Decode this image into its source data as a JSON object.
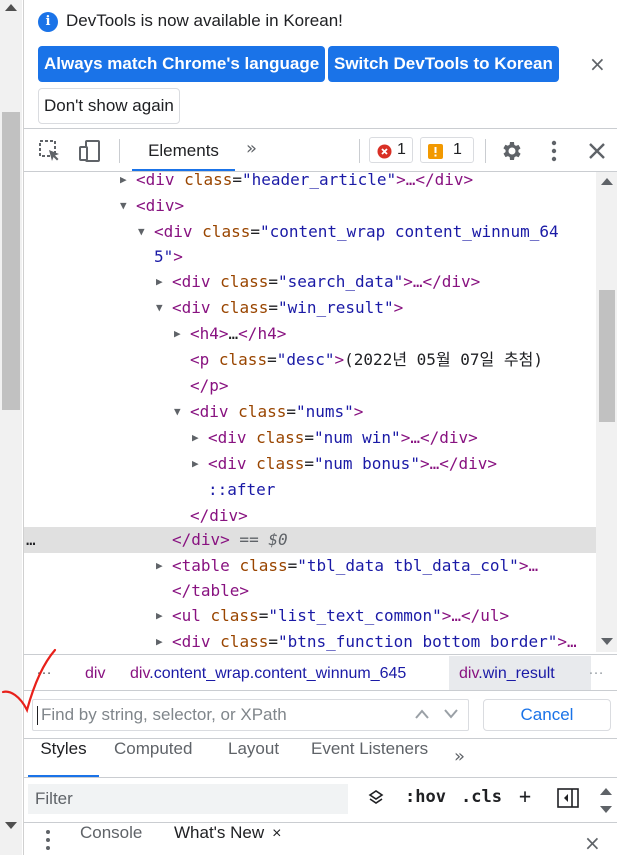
{
  "infobar": {
    "message": "DevTools is now available in Korean!",
    "btn_match": "Always match Chrome's language",
    "btn_switch": "Switch DevTools to Korean",
    "btn_dont_show": "Don't show again",
    "close_glyph": "×"
  },
  "toolbar": {
    "tab_elements": "Elements",
    "more_tabs_glyph": "»",
    "error_count": "1",
    "warning_count": "1",
    "colors": {
      "accent": "#1a73e8",
      "error": "#d93025",
      "warning": "#f29900"
    }
  },
  "tree": {
    "lines": [
      {
        "tri": "▶",
        "tag_open": "<div ",
        "attr": "class",
        "eq": "=",
        "val": "\"header_article\"",
        "close": ">…</div>"
      },
      {
        "tri": "▼",
        "tag_open": "<div>"
      },
      {
        "tri": "▼",
        "tag_open": "<div ",
        "attr": "class",
        "eq": "=",
        "val": "\"content_wrap content_winnum_64"
      },
      {
        "val": "5\"",
        "close": ">"
      },
      {
        "tri": "▶",
        "tag_open": "<div ",
        "attr": "class",
        "eq": "=",
        "val": "\"search_data\"",
        "close": ">…</div>"
      },
      {
        "tri": "▼",
        "tag_open": "<div ",
        "attr": "class",
        "eq": "=",
        "val": "\"win_result\"",
        "close": ">"
      },
      {
        "tri": "▶",
        "tag_open": "<h4>",
        "text": "…",
        "close": "</h4>"
      },
      {
        "tag_open": "<p ",
        "attr": "class",
        "eq": "=",
        "val": "\"desc\"",
        "close": ">",
        "text": "(2022년 05월 07일 추첨)"
      },
      {
        "close": "</p>"
      },
      {
        "tri": "▼",
        "tag_open": "<div ",
        "attr": "class",
        "eq": "=",
        "val": "\"nums\"",
        "close": ">"
      },
      {
        "tri": "▶",
        "tag_open": "<div ",
        "attr": "class",
        "eq": "=",
        "val": "\"num win\"",
        "close": ">…</div>"
      },
      {
        "tri": "▶",
        "tag_open": "<div ",
        "attr": "class",
        "eq": "=",
        "val": "\"num bonus\"",
        "close": ">…</div>"
      },
      {
        "pseudo": "::after"
      },
      {
        "close": "</div>"
      },
      {
        "close": "</div>",
        "dollar": " == $0",
        "dots": "…"
      },
      {
        "tri": "▶",
        "tag_open": "<table ",
        "attr": "class",
        "eq": "=",
        "val": "\"tbl_data tbl_data_col\"",
        "close": ">…"
      },
      {
        "close": "</table>"
      },
      {
        "tri": "▶",
        "tag_open": "<ul ",
        "attr": "class",
        "eq": "=",
        "val": "\"list_text_common\"",
        "close": ">…</ul>"
      },
      {
        "tri": "▶",
        "tag_open": "<div ",
        "attr": "class",
        "eq": "=",
        "val": "\"btns_function bottom border\"",
        "close": ">…"
      }
    ]
  },
  "breadcrumb": {
    "leading_dots": "…",
    "item1": "div",
    "item2_tag": "div",
    "item2_cls": ".content_wrap.content_winnum_645",
    "item3_tag": "div",
    "item3_cls": ".win_result",
    "trailing_dots": "…"
  },
  "search": {
    "placeholder": "Find by string, selector, or XPath",
    "cancel_label": "Cancel"
  },
  "styles_tabs": [
    "Styles",
    "Computed",
    "Layout",
    "Event Listeners"
  ],
  "styles_more_glyph": "»",
  "filter": {
    "placeholder": "Filter",
    "hov": ":hov",
    "cls": ".cls",
    "plus": "+"
  },
  "drawer": {
    "tab_console": "Console",
    "tab_whats_new": "What's New",
    "tab_close_glyph": "×",
    "close_glyph": "×"
  }
}
